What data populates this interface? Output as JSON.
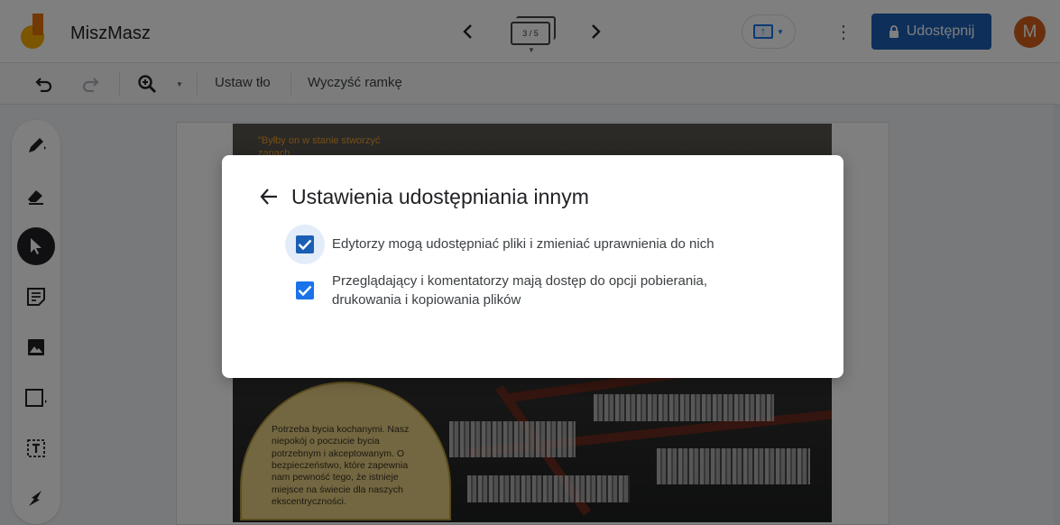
{
  "app": {
    "title": "MiszMasz",
    "frame_counter": "3 / 5",
    "share_label": "Udostępnij",
    "avatar_initial": "M"
  },
  "toolbar": {
    "set_background": "Ustaw tło",
    "clear_frame": "Wyczyść ramkę"
  },
  "tools": [
    "pen-icon",
    "eraser-icon",
    "select-icon",
    "sticky-note-icon",
    "image-icon",
    "shape-icon",
    "text-box-icon",
    "laser-icon"
  ],
  "slide": {
    "quote_text": "\"Byłby on w stanie stworzyć zapach",
    "arch_text": "Potrzeba bycia kochanymi. Nasz niepokój o poczucie bycia potrzebnym i akceptowanym. O bezpieczeństwo, które zapewnia nam pewność tego, że istnieje miejsce na świecie dla naszych ekscentryczności."
  },
  "dialog": {
    "title": "Ustawienia udostępniania innym",
    "options": [
      {
        "label": "Edytorzy mogą udostępniać pliki i zmieniać uprawnienia do nich",
        "checked": true
      },
      {
        "label": "Przeglądający i komentatorzy mają dostęp do opcji pobierania, drukowania i kopiowania plików",
        "checked": true
      }
    ]
  },
  "colors": {
    "primary": "#1a5fb4",
    "avatar": "#d5601a",
    "scrim": "rgba(0,0,0,0.5)"
  }
}
